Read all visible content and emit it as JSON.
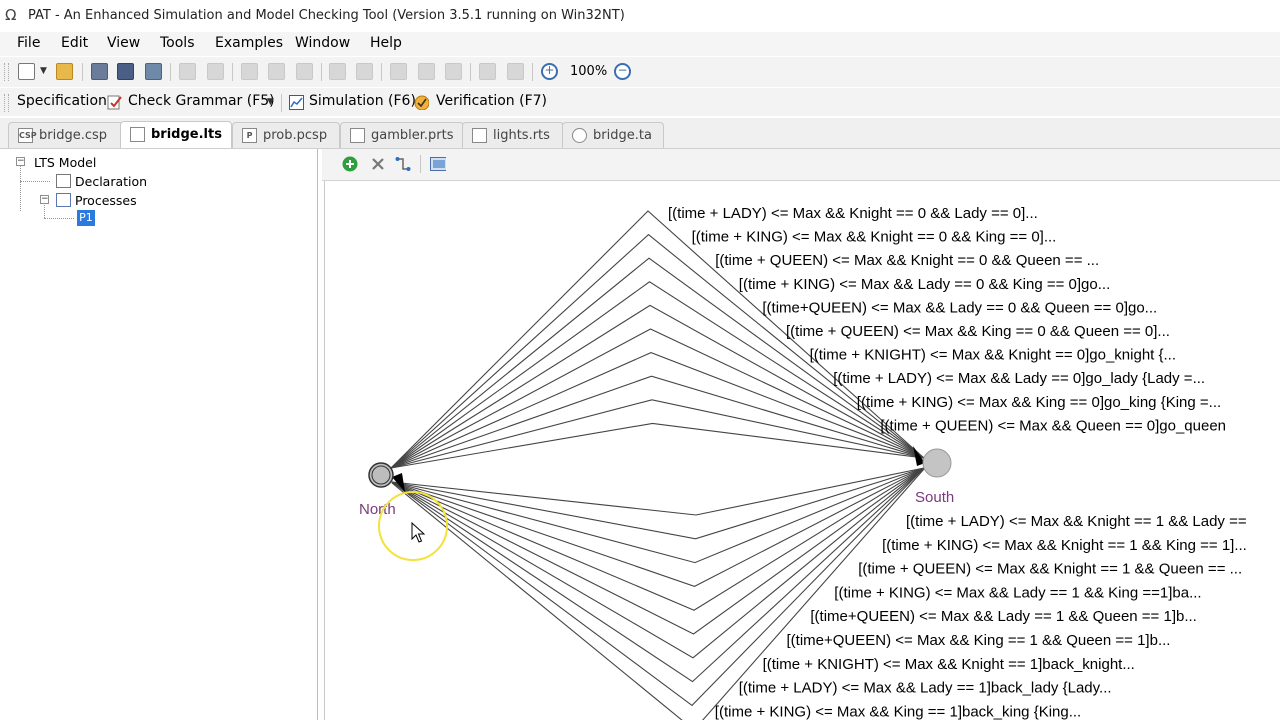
{
  "window": {
    "title": "PAT - An Enhanced Simulation and Model Checking Tool (Version 3.5.1 running on Win32NT)"
  },
  "menu": [
    "File",
    "Edit",
    "View",
    "Tools",
    "Examples",
    "Window",
    "Help"
  ],
  "toolbar": {
    "zoom": "100%"
  },
  "toolbar2": {
    "specification": "Specification",
    "check_grammar": "Check Grammar (F5)",
    "simulation": "Simulation (F6)",
    "verification": "Verification (F7)"
  },
  "tabs": [
    {
      "label": "bridge.csp",
      "icon": "csp-file-icon",
      "icon_text": "CSP"
    },
    {
      "label": "bridge.lts",
      "icon": "lts-file-icon",
      "icon_text": ""
    },
    {
      "label": "prob.pcsp",
      "icon": "pcsp-file-icon",
      "icon_text": "P"
    },
    {
      "label": "gambler.prts",
      "icon": "prts-file-icon",
      "icon_text": ""
    },
    {
      "label": "lights.rts",
      "icon": "rts-file-icon",
      "icon_text": ""
    },
    {
      "label": "bridge.ta",
      "icon": "clock-icon",
      "icon_text": ""
    }
  ],
  "tree": {
    "root": "LTS Model",
    "declaration": "Declaration",
    "processes": "Processes",
    "p1": "P1"
  },
  "graph": {
    "states": {
      "north": "North",
      "south": "South"
    },
    "upper_edges": [
      "[(time + LADY) <= Max && Knight == 0 && Lady == 0]...",
      "[(time + KING) <= Max && Knight == 0 && King == 0]...",
      "[(time + QUEEN) <= Max && Knight == 0 && Queen == ...",
      "[(time + KING) <= Max && Lady == 0 && King == 0]go...",
      "[(time+QUEEN) <= Max && Lady == 0 && Queen == 0]go...",
      "[(time + QUEEN) <= Max && King == 0 && Queen == 0]...",
      "[(time + KNIGHT) <= Max && Knight == 0]go_knight {...",
      "[(time + LADY) <= Max && Lady == 0]go_lady {Lady =...",
      "[(time + KING) <= Max && King == 0]go_king {King =...",
      "[(time + QUEEN) <= Max && Queen == 0]go_queen"
    ],
    "lower_edges": [
      "[(time + LADY) <= Max  && Knight == 1 && Lady ==",
      "[(time + KING) <= Max && Knight == 1 && King == 1]...",
      "[(time + QUEEN) <= Max && Knight == 1 && Queen == ...",
      "[(time + KING) <= Max && Lady == 1 && King ==1]ba...",
      "[(time+QUEEN) <= Max  && Lady == 1 && Queen == 1]b...",
      "[(time+QUEEN) <= Max  && King == 1 && Queen == 1]b...",
      "[(time + KNIGHT) <= Max && Knight == 1]back_knight...",
      "[(time + LADY) <= Max && Lady == 1]back_lady {Lady...",
      "[(time + KING) <= Max && King == 1]back_king {King..."
    ]
  }
}
